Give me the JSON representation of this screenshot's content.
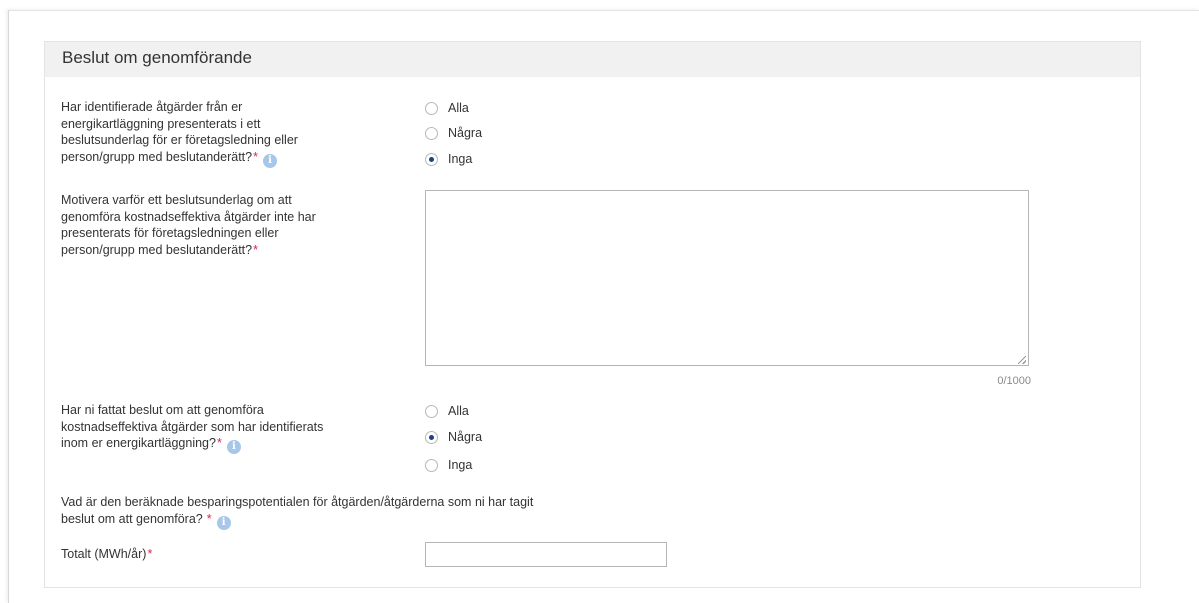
{
  "section": {
    "title": "Beslut om genomförande"
  },
  "q1": {
    "label_lines": [
      "Har identifierade åtgärder från er",
      "energikartläggning presenterats i ett",
      "beslutsunderlag för er företagsledning eller",
      "person/grupp med beslutanderätt?"
    ],
    "required": "*",
    "options": [
      "Alla",
      "Några",
      "Inga"
    ],
    "selected": "Inga"
  },
  "q2": {
    "label_lines": [
      "Motivera varför ett beslutsunderlag om att",
      "genomföra kostnadseffektiva åtgärder inte har",
      "presenterats för företagsledningen eller",
      "person/grupp med beslutanderätt?"
    ],
    "required": "*",
    "value": "",
    "counter": "0/1000"
  },
  "q3": {
    "label_lines": [
      "Har ni fattat beslut om att genomföra",
      "kostnadseffektiva åtgärder som har identifierats",
      "inom er energikartläggning?"
    ],
    "required": "*",
    "options": [
      "Alla",
      "Några",
      "Inga"
    ],
    "selected": "Några"
  },
  "q4": {
    "label_lines": [
      "Vad är den beräknade besparingspotentialen för åtgärden/åtgärderna som ni har tagit",
      "beslut om att genomföra?"
    ],
    "required": "*"
  },
  "total": {
    "label": "Totalt (MWh/år)",
    "required": "*",
    "value": ""
  },
  "icons": {
    "info": "info-icon",
    "info_glyph": "i"
  },
  "colors": {
    "required": "#e0244a",
    "info": "#a7c7ea",
    "radio_selected": "#1c3f8f"
  }
}
